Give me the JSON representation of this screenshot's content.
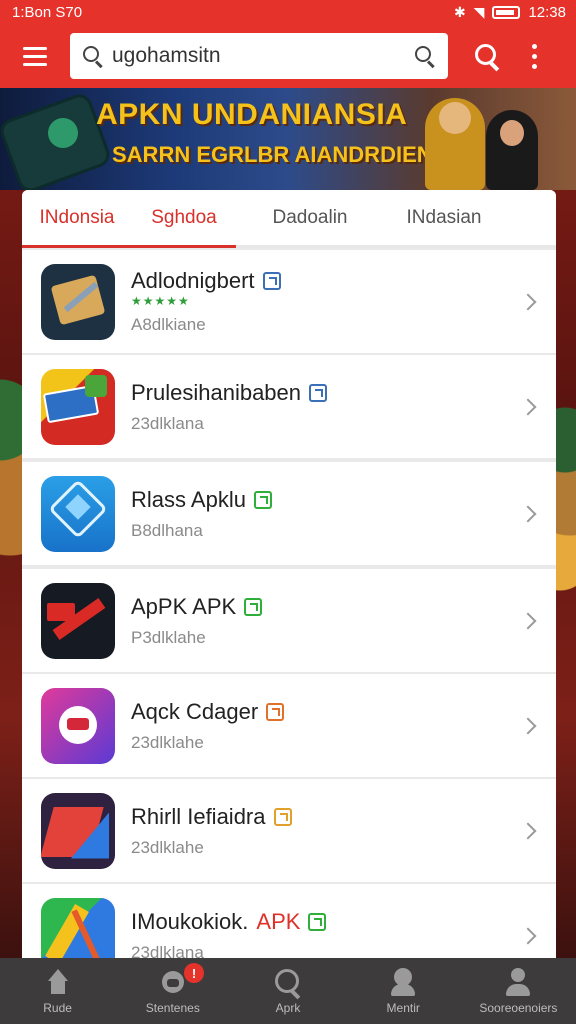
{
  "status_bar": {
    "left_text": "1:Bon S70",
    "time": "12:38"
  },
  "appbar": {
    "search_value": "ugohamsitn"
  },
  "banner": {
    "title": "APKN UNDANIANSIA",
    "subtitle": "SARRN EGRLBR AIANDRDIEN"
  },
  "tabs": [
    {
      "label": "INdonsia"
    },
    {
      "label": "Sghdoa"
    },
    {
      "label": "Dadoalin"
    },
    {
      "label": "INdasian"
    }
  ],
  "apps": [
    {
      "name": "Adlodnigbert",
      "name_suffix": "",
      "rating": "★★★★★",
      "sub": "A8dlkiane",
      "badge_color": "#3b6fb6",
      "icon": "scroll-icon"
    },
    {
      "name": "Prulesihanibaben",
      "name_suffix": "",
      "rating": "",
      "sub": "23dlklana",
      "badge_color": "#3b6fb6",
      "icon": "lipf-icon"
    },
    {
      "name": "Rlass Apklu",
      "name_suffix": "",
      "rating": "",
      "sub": "B8dlhana",
      "badge_color": "#2fae3a",
      "icon": "diamond-icon"
    },
    {
      "name": "ApPK APK",
      "name_suffix": "",
      "rating": "",
      "sub": "P3dlklahe",
      "badge_color": "#2fae3a",
      "icon": "arrow-icon"
    },
    {
      "name": "Aqck Cdager",
      "name_suffix": "",
      "rating": "",
      "sub": "23dlklahe",
      "badge_color": "#e0702a",
      "icon": "disc-icon"
    },
    {
      "name": "Rhirll Iefiaidra",
      "name_suffix": "",
      "rating": "",
      "sub": "23dlklahe",
      "badge_color": "#e0a02a",
      "icon": "pen-icon"
    },
    {
      "name": "IMoukokiok.",
      "name_suffix": "APK",
      "rating": "",
      "sub": "23dlklana",
      "badge_color": "#2fae3a",
      "icon": "pencil-icon"
    }
  ],
  "bottom_nav": [
    {
      "label": "Rude"
    },
    {
      "label": "Stentenes",
      "badge": "!"
    },
    {
      "label": "Aprk"
    },
    {
      "label": "Mentir"
    },
    {
      "label": "Sooreoenoiers"
    }
  ],
  "colors": {
    "accent": "#e5322b",
    "nav_bg": "#3d3b3c"
  }
}
